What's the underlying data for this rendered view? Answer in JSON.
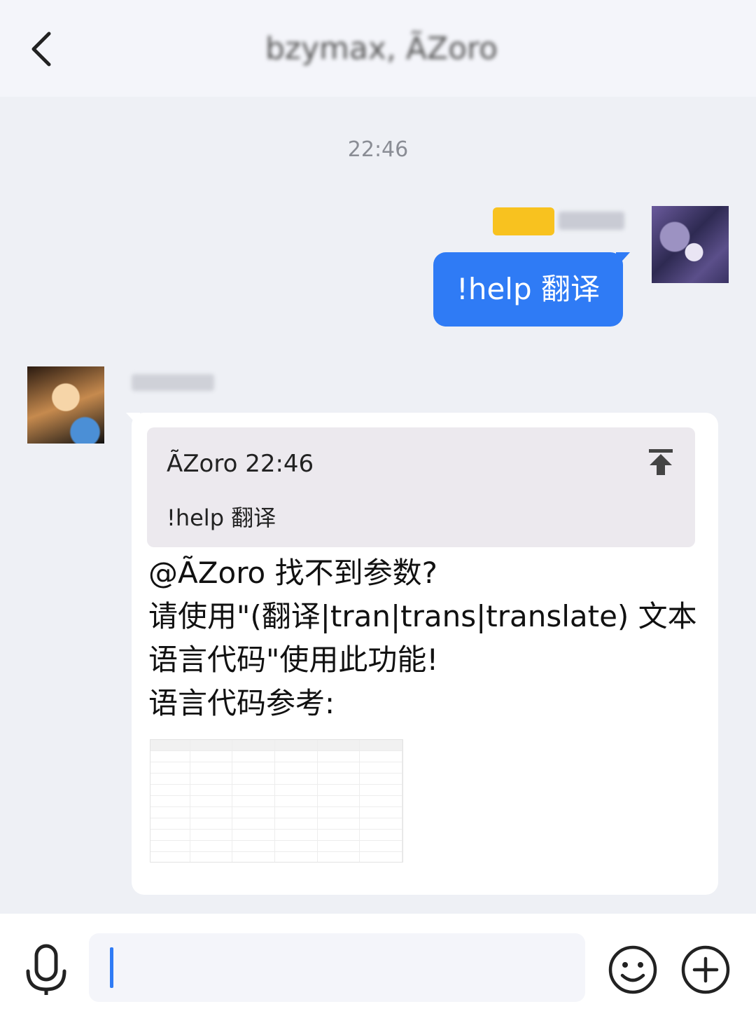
{
  "header": {
    "title": "bzymax, ÃZoro"
  },
  "chat": {
    "time": "22:46",
    "outgoing": {
      "text": "!help 翻译"
    },
    "incoming": {
      "quote": {
        "header": "ÃZoro 22:46",
        "text": "!help 翻译"
      },
      "reply": "@ÃZoro 找不到参数?\n请使用\"(翻译|tran|trans|translate) 文本 语言代码\"使用此功能!\n语言代码参考:"
    }
  },
  "input_bar": {
    "placeholder": ""
  },
  "colors": {
    "accent_blue": "#2f7bf5",
    "header_bg": "#f4f5fa",
    "chat_bg": "#eef0f5",
    "tag_yellow": "#f8c21f"
  },
  "icons": [
    "chevron-left-icon",
    "arrow-to-top-icon",
    "microphone-icon",
    "smiley-icon",
    "plus-circle-icon"
  ]
}
